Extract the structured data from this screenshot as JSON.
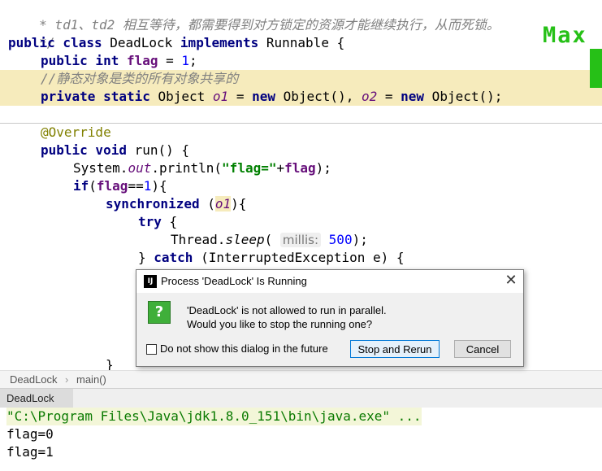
{
  "editor": {
    "lines": {
      "l0": {
        "text": " * td1、td2 相互等待，都需要得到对方锁定的资源才能继续执行，从而死锁。"
      },
      "l1": {
        "text": " */"
      },
      "l2": {
        "kw1": "public class",
        "name": " DeadLock ",
        "kw2": "implements",
        "rest": " Runnable {"
      },
      "l3": {
        "kw": "public int",
        "sp": " ",
        "fld": "flag",
        "eq": " = ",
        "num": "1",
        "end": ";"
      },
      "l4": {
        "text": "//静态对象是类的所有对象共享的"
      },
      "l5": {
        "kw1": "private static",
        "t": " Object ",
        "f1": "o1",
        "eq": " = ",
        "kw2": "new",
        "t2": " Object(), ",
        "f2": "o2",
        "eq2": " = ",
        "kw3": "new",
        "t3": " Object();"
      },
      "l6": {
        "text": "@Override"
      },
      "l7": {
        "kw": "public void",
        "rest": " run() {"
      },
      "l8": {
        "a": "System.",
        "out": "out",
        "b": ".println(",
        "str": "\"flag=\"",
        "c": "+",
        "fld": "flag",
        "d": ");"
      },
      "l9": {
        "kw": "if",
        "a": "(",
        "fld": "flag",
        "b": "==",
        "num": "1",
        "c": "){"
      },
      "l10": {
        "kw": "synchronized",
        "a": " (",
        "f": "o1",
        "b": "){"
      },
      "l11": {
        "kw": "try",
        "rest": " {"
      },
      "l12": {
        "a": "Thread.",
        "m": "sleep",
        "b": "( ",
        "hint": "millis:",
        "sp": " ",
        "num": "500",
        "c": ");"
      },
      "l13": {
        "a": "} ",
        "kw": "catch",
        "rest": " (InterruptedException e) {"
      },
      "l14": {
        "text": "}"
      }
    }
  },
  "badge": {
    "text": "Max"
  },
  "breadcrumb": {
    "file": "DeadLock",
    "sep": "›",
    "method": "main()"
  },
  "run_panel": {
    "tab_label": "DeadLock"
  },
  "console": {
    "lines": [
      "\"C:\\Program Files\\Java\\jdk1.8.0_151\\bin\\java.exe\" ...",
      "flag=0",
      "flag=1"
    ]
  },
  "dialog": {
    "title": "Process 'DeadLock' Is Running",
    "close_glyph": "✕",
    "icon_glyph": "?",
    "app_icon_glyph": "IJ",
    "message_line1": "'DeadLock' is not allowed to run in parallel.",
    "message_line2": "Would you like to stop the running one?",
    "checkbox_label": "Do not show this dialog in the future",
    "checkbox_checked": false,
    "primary_button": "Stop and Rerun",
    "cancel_button": "Cancel"
  },
  "colors": {
    "keyword": "#000080",
    "field": "#660e7a",
    "number": "#0000ff",
    "string": "#008000",
    "comment": "#808080",
    "annotation": "#808000",
    "highlight": "#f6ebbc",
    "badge": "#26c017"
  }
}
